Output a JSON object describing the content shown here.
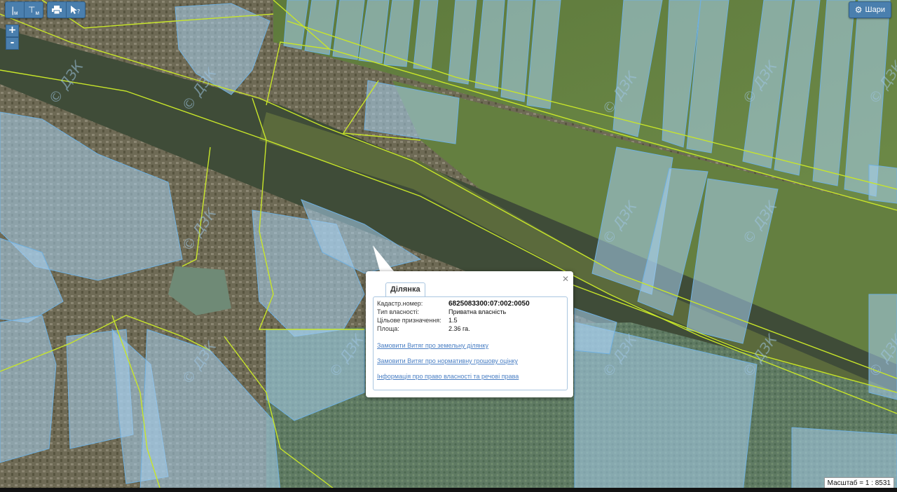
{
  "toolbar": {
    "measure_length_icon": "ruler-length-icon",
    "measure_length_label": "м",
    "measure_area_icon": "ruler-area-icon",
    "measure_area_label": "м",
    "print_icon": "printer-icon",
    "identify_icon": "cursor-help-icon"
  },
  "zoom": {
    "in_label": "+",
    "out_label": "-"
  },
  "layers": {
    "label": "Шари",
    "icon": "gear-icon"
  },
  "popup": {
    "tab_label": "Ділянка",
    "fields": [
      {
        "label": "Кадастр.номер:",
        "value": "6825083300:07:002:0050"
      },
      {
        "label": "Тип власності:",
        "value": "Приватна власність"
      },
      {
        "label": "Цільове призначення:",
        "value": "1.5"
      },
      {
        "label": "Площа:",
        "value": "2.36 га."
      }
    ],
    "links": [
      "Замовити Витяг про земельну ділянку",
      "Замовити Витяг про нормативну грошову оцінку",
      "Інформація про право власності та речові права"
    ]
  },
  "scale": {
    "label": "Масштаб = 1 : 8531"
  },
  "watermark": "© ДЗК",
  "colors": {
    "parcel_fill": "#a8d0ee",
    "parcel_stroke": "#6fb0e0",
    "boundary_line": "#c8e629",
    "control_bg": "#4a7fae",
    "link": "#4a7fc4"
  }
}
